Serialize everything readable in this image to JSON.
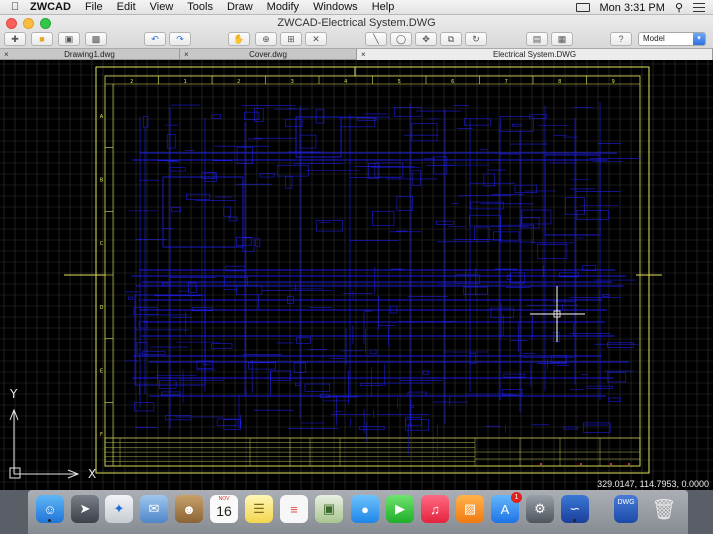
{
  "menubar": {
    "app_name": "ZWCAD",
    "items": [
      "File",
      "Edit",
      "View",
      "Tools",
      "Draw",
      "Modify",
      "Windows",
      "Help"
    ],
    "clock": "Mon 3:31 PM"
  },
  "window": {
    "title": "ZWCAD-Electrical System.DWG"
  },
  "toolbar": {
    "model_select": "Model"
  },
  "tabs": [
    {
      "label": "Drawing1.dwg",
      "active": false
    },
    {
      "label": "Cover.dwg",
      "active": false
    },
    {
      "label": "Electrical System.DWG",
      "active": true
    }
  ],
  "drawing": {
    "column_labels": [
      "2",
      "1",
      "2",
      "3",
      "4",
      "5",
      "6",
      "7",
      "8",
      "9"
    ],
    "row_labels": [
      "A",
      "B",
      "C",
      "D",
      "E",
      "F"
    ],
    "ucs_x": "X",
    "ucs_y": "Y",
    "coordinates": "329.0147, 114.7953, 0.0000",
    "colors": {
      "background": "#000000",
      "frame": "#e3e35a",
      "linework": "#1d1de0",
      "grid": "#333333",
      "crosshair": "#ffffff"
    }
  },
  "dock": {
    "calendar_month": "NOV",
    "calendar_day": "16",
    "appstore_badge": "1",
    "dwg_label": "DWG"
  }
}
